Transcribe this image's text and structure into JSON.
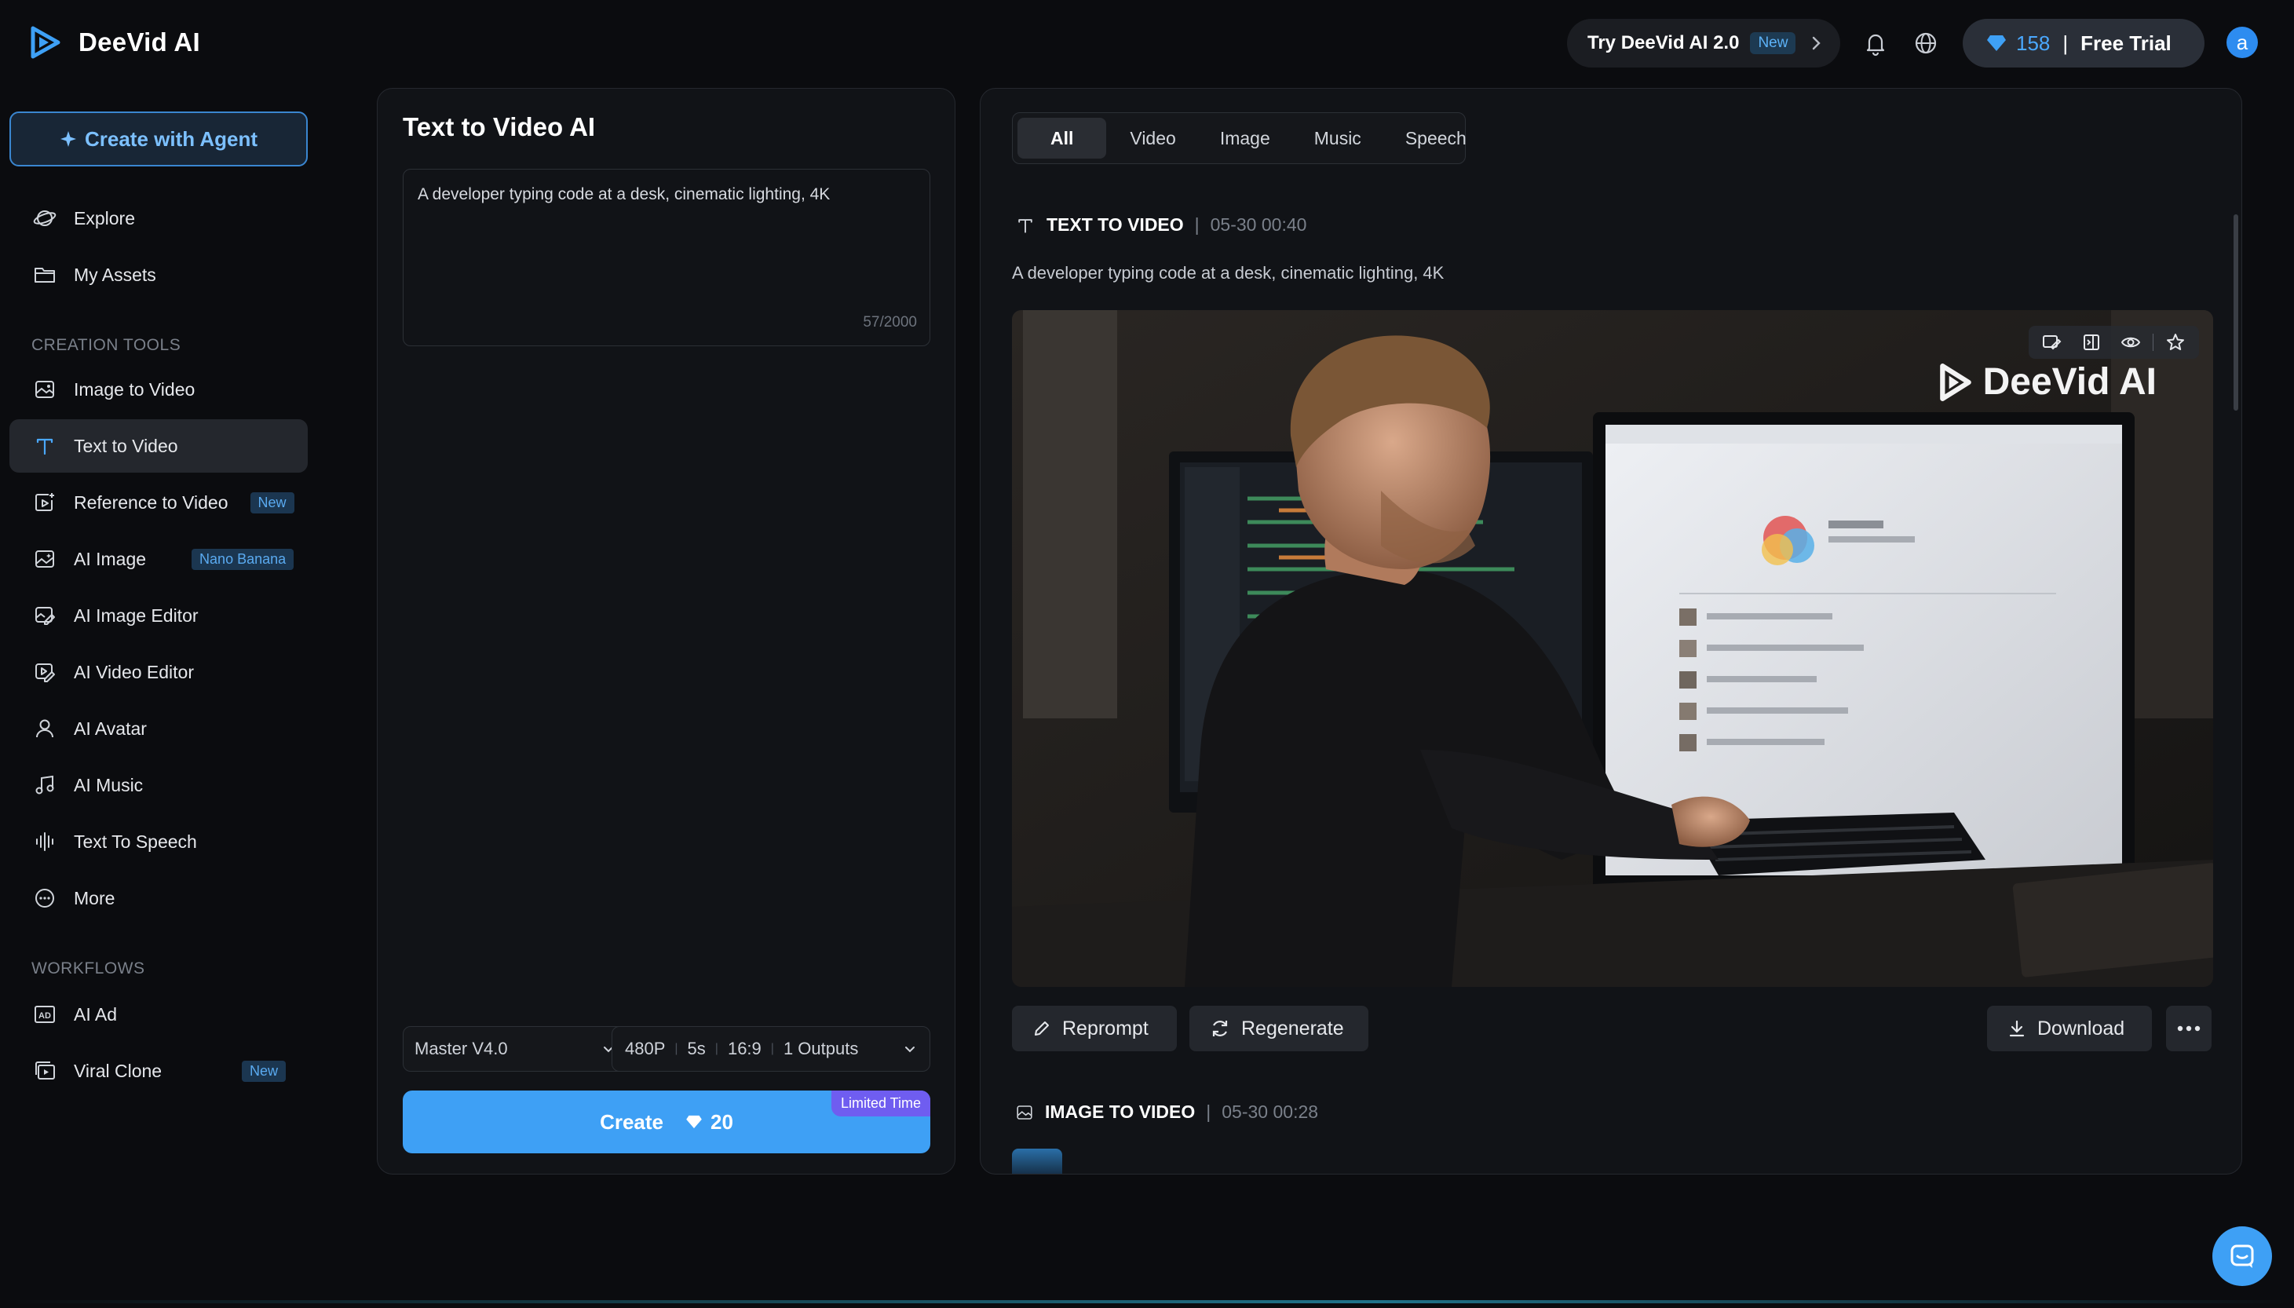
{
  "app": {
    "name": "DeeVid AI"
  },
  "header": {
    "try_label": "Try DeeVid AI 2.0",
    "try_badge": "New",
    "credits": "158",
    "credits_separator": "|",
    "plan": "Free Trial",
    "avatar_letter": "a",
    "icons": [
      "bell-icon",
      "globe-icon",
      "diamond-icon",
      "chevron-right-icon"
    ]
  },
  "sidebar": {
    "agent_button": "Create with Agent",
    "top_items": [
      {
        "label": "Explore",
        "icon": "explore-icon"
      },
      {
        "label": "My Assets",
        "icon": "folder-icon"
      }
    ],
    "creation_tools_title": "CREATION TOOLS",
    "creation_tools": [
      {
        "label": "Image to Video",
        "icon": "image-icon"
      },
      {
        "label": "Text to Video",
        "icon": "text-icon",
        "active": true
      },
      {
        "label": "Reference to Video",
        "icon": "reference-video-icon",
        "tag": "New"
      },
      {
        "label": "AI Image",
        "icon": "ai-image-icon",
        "tag": "Nano Banana"
      },
      {
        "label": "AI Image Editor",
        "icon": "image-editor-icon"
      },
      {
        "label": "AI Video Editor",
        "icon": "video-editor-icon"
      },
      {
        "label": "AI Avatar",
        "icon": "user-icon"
      },
      {
        "label": "AI Music",
        "icon": "music-icon"
      },
      {
        "label": "Text To Speech",
        "icon": "waveform-icon"
      },
      {
        "label": "More",
        "icon": "more-circle-icon"
      }
    ],
    "workflows_title": "WORKFLOWS",
    "workflows": [
      {
        "label": "AI Ad",
        "icon": "ad-icon"
      },
      {
        "label": "Viral Clone",
        "icon": "clone-icon",
        "tag": "New"
      }
    ]
  },
  "left_panel": {
    "title": "Text to Video AI",
    "prompt": "A developer typing code at a desk, cinematic lighting, 4K",
    "char_count": "57/2000",
    "model": "Master V4.0",
    "options": [
      "480P",
      "5s",
      "16:9",
      "1 Outputs"
    ],
    "create_label": "Create",
    "create_cost": "20",
    "limited_badge": "Limited Time"
  },
  "right_panel": {
    "tabs": [
      "All",
      "Video",
      "Image",
      "Music",
      "Speech"
    ],
    "active_tab": "All",
    "generations": [
      {
        "kind": "TEXT TO VIDEO",
        "time": "05-30 00:40",
        "prompt": "A developer typing code at a desk, cinematic lighting, 4K",
        "watermark": "DeeVid AI",
        "actions": {
          "reprompt": "Reprompt",
          "regenerate": "Regenerate",
          "download": "Download"
        }
      },
      {
        "kind": "IMAGE TO VIDEO",
        "time": "05-30 00:28"
      }
    ]
  },
  "colors": {
    "accent": "#3ea0f5",
    "background": "#0b0c0f",
    "panel": "#111317",
    "limited": "#6f5df0"
  }
}
